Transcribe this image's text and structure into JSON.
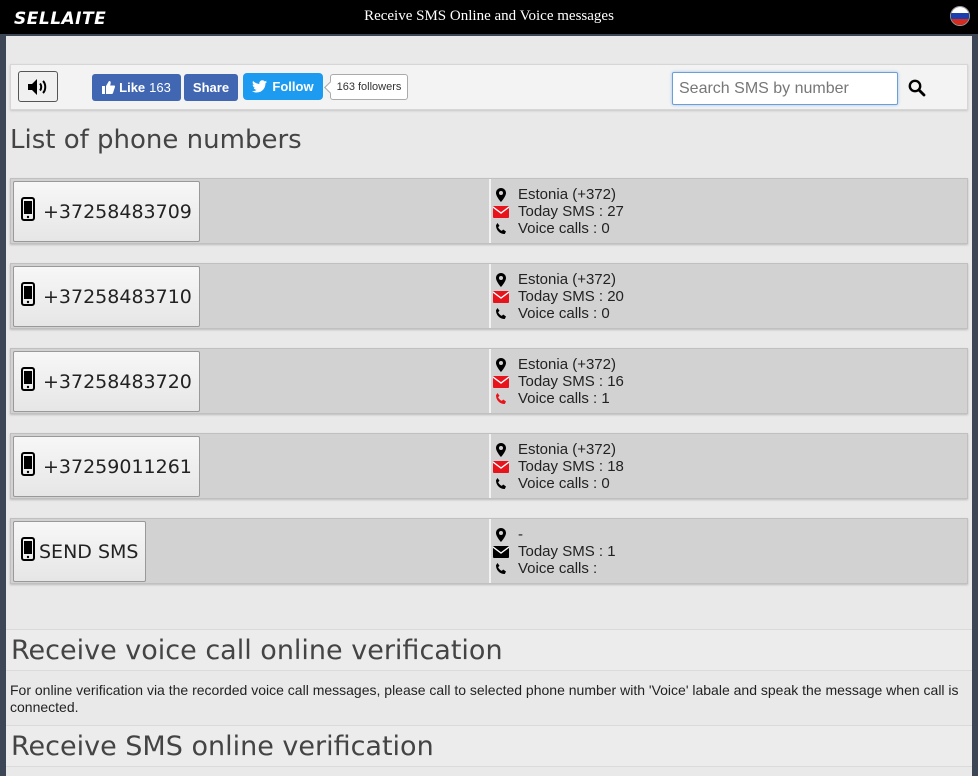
{
  "header": {
    "logo": "SELLAITE",
    "title": "Receive SMS Online and Voice messages"
  },
  "toolbar": {
    "like_label": "Like",
    "like_count": "163",
    "share_label": "Share",
    "follow_label": "Follow",
    "followers_text": "163 followers",
    "search_placeholder": "Search SMS by number"
  },
  "list_heading": "List of phone numbers",
  "numbers": [
    {
      "number": "+37258483709",
      "country": "Estonia (+372)",
      "sms": "Today SMS : 27",
      "calls": "Voice calls : 0",
      "sms_icon": "red",
      "call_icon": "black"
    },
    {
      "number": "+37258483710",
      "country": "Estonia (+372)",
      "sms": "Today SMS : 20",
      "calls": "Voice calls : 0",
      "sms_icon": "red",
      "call_icon": "black"
    },
    {
      "number": "+37258483720",
      "country": "Estonia (+372)",
      "sms": "Today SMS : 16",
      "calls": "Voice calls : 1",
      "sms_icon": "red",
      "call_icon": "red"
    },
    {
      "number": "+37259011261",
      "country": "Estonia (+372)",
      "sms": "Today SMS : 18",
      "calls": "Voice calls : 0",
      "sms_icon": "red",
      "call_icon": "black"
    },
    {
      "number": "SEND SMS",
      "country": "-",
      "sms": "Today SMS : 1",
      "calls": "Voice calls :",
      "sms_icon": "black",
      "call_icon": "black"
    }
  ],
  "voice_section": {
    "title": "Receive voice call online verification",
    "text": "For online verification via the recorded voice call messages, please call to selected phone number with 'Voice' labale and speak the message when call is connected."
  },
  "sms_section": {
    "title": "Receive SMS online verification"
  },
  "colors": {
    "accent_red": "#e8141b",
    "facebook": "#4267b2",
    "twitter": "#1d9bf0"
  }
}
